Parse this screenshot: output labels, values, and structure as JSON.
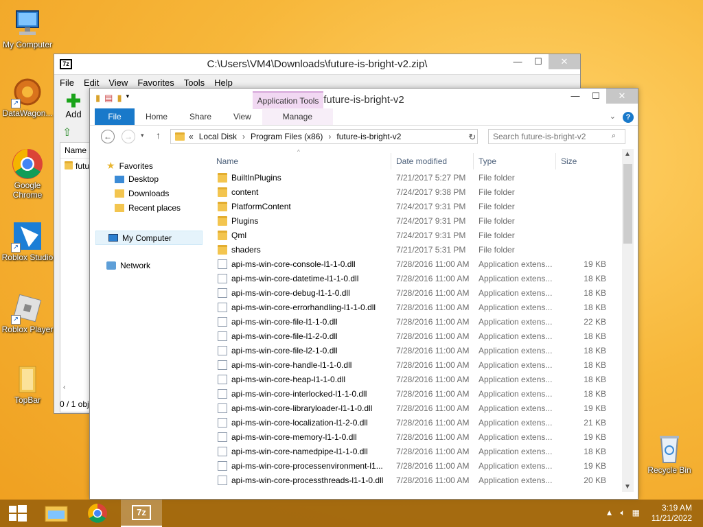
{
  "desktop_icons": [
    {
      "label": "My Computer",
      "icon": "my-computer-icon"
    },
    {
      "label": "DataWagon...",
      "icon": "datawagon-icon"
    },
    {
      "label": "Google Chrome",
      "icon": "chrome-icon"
    },
    {
      "label": "Roblox Studio",
      "icon": "roblox-studio-icon"
    },
    {
      "label": "Roblox Player",
      "icon": "roblox-player-icon"
    },
    {
      "label": "TopBar",
      "icon": "folder-icon"
    },
    {
      "label": "Recycle Bin",
      "icon": "recycle-bin-icon"
    }
  ],
  "sevenzip": {
    "title": "C:\\Users\\VM4\\Downloads\\future-is-bright-v2.zip\\",
    "logo": "7z",
    "menu": [
      "File",
      "Edit",
      "View",
      "Favorites",
      "Tools",
      "Help"
    ],
    "add_label": "Add",
    "column_name": "Name",
    "item_name": "futu",
    "status": "0 / 1 obj"
  },
  "explorer": {
    "title": "future-is-bright-v2",
    "context_tab": "Application Tools",
    "tabs": [
      "File",
      "Home",
      "Share",
      "View",
      "Manage"
    ],
    "address": [
      "«",
      "Local Disk",
      "Program Files (x86)",
      "future-is-bright-v2"
    ],
    "search_placeholder": "Search future-is-bright-v2",
    "nav": {
      "favorites": "Favorites",
      "desktop": "Desktop",
      "downloads": "Downloads",
      "recent": "Recent places",
      "computer": "My Computer",
      "network": "Network"
    },
    "columns": {
      "name": "Name",
      "date": "Date modified",
      "type": "Type",
      "size": "Size"
    },
    "rows": [
      {
        "name": "BuiltInPlugins",
        "date": "7/21/2017 5:27 PM",
        "type": "File folder",
        "size": "",
        "kind": "folder"
      },
      {
        "name": "content",
        "date": "7/24/2017 9:38 PM",
        "type": "File folder",
        "size": "",
        "kind": "folder"
      },
      {
        "name": "PlatformContent",
        "date": "7/24/2017 9:31 PM",
        "type": "File folder",
        "size": "",
        "kind": "folder"
      },
      {
        "name": "Plugins",
        "date": "7/24/2017 9:31 PM",
        "type": "File folder",
        "size": "",
        "kind": "folder"
      },
      {
        "name": "Qml",
        "date": "7/24/2017 9:31 PM",
        "type": "File folder",
        "size": "",
        "kind": "folder"
      },
      {
        "name": "shaders",
        "date": "7/21/2017 5:31 PM",
        "type": "File folder",
        "size": "",
        "kind": "folder"
      },
      {
        "name": "api-ms-win-core-console-l1-1-0.dll",
        "date": "7/28/2016 11:00 AM",
        "type": "Application extens...",
        "size": "19 KB",
        "kind": "file"
      },
      {
        "name": "api-ms-win-core-datetime-l1-1-0.dll",
        "date": "7/28/2016 11:00 AM",
        "type": "Application extens...",
        "size": "18 KB",
        "kind": "file"
      },
      {
        "name": "api-ms-win-core-debug-l1-1-0.dll",
        "date": "7/28/2016 11:00 AM",
        "type": "Application extens...",
        "size": "18 KB",
        "kind": "file"
      },
      {
        "name": "api-ms-win-core-errorhandling-l1-1-0.dll",
        "date": "7/28/2016 11:00 AM",
        "type": "Application extens...",
        "size": "18 KB",
        "kind": "file"
      },
      {
        "name": "api-ms-win-core-file-l1-1-0.dll",
        "date": "7/28/2016 11:00 AM",
        "type": "Application extens...",
        "size": "22 KB",
        "kind": "file"
      },
      {
        "name": "api-ms-win-core-file-l1-2-0.dll",
        "date": "7/28/2016 11:00 AM",
        "type": "Application extens...",
        "size": "18 KB",
        "kind": "file"
      },
      {
        "name": "api-ms-win-core-file-l2-1-0.dll",
        "date": "7/28/2016 11:00 AM",
        "type": "Application extens...",
        "size": "18 KB",
        "kind": "file"
      },
      {
        "name": "api-ms-win-core-handle-l1-1-0.dll",
        "date": "7/28/2016 11:00 AM",
        "type": "Application extens...",
        "size": "18 KB",
        "kind": "file"
      },
      {
        "name": "api-ms-win-core-heap-l1-1-0.dll",
        "date": "7/28/2016 11:00 AM",
        "type": "Application extens...",
        "size": "18 KB",
        "kind": "file"
      },
      {
        "name": "api-ms-win-core-interlocked-l1-1-0.dll",
        "date": "7/28/2016 11:00 AM",
        "type": "Application extens...",
        "size": "18 KB",
        "kind": "file"
      },
      {
        "name": "api-ms-win-core-libraryloader-l1-1-0.dll",
        "date": "7/28/2016 11:00 AM",
        "type": "Application extens...",
        "size": "19 KB",
        "kind": "file"
      },
      {
        "name": "api-ms-win-core-localization-l1-2-0.dll",
        "date": "7/28/2016 11:00 AM",
        "type": "Application extens...",
        "size": "21 KB",
        "kind": "file"
      },
      {
        "name": "api-ms-win-core-memory-l1-1-0.dll",
        "date": "7/28/2016 11:00 AM",
        "type": "Application extens...",
        "size": "19 KB",
        "kind": "file"
      },
      {
        "name": "api-ms-win-core-namedpipe-l1-1-0.dll",
        "date": "7/28/2016 11:00 AM",
        "type": "Application extens...",
        "size": "18 KB",
        "kind": "file"
      },
      {
        "name": "api-ms-win-core-processenvironment-l1...",
        "date": "7/28/2016 11:00 AM",
        "type": "Application extens...",
        "size": "19 KB",
        "kind": "file"
      },
      {
        "name": "api-ms-win-core-processthreads-l1-1-0.dll",
        "date": "7/28/2016 11:00 AM",
        "type": "Application extens...",
        "size": "20 KB",
        "kind": "file"
      }
    ]
  },
  "taskbar": {
    "time": "3:19 AM",
    "date": "11/21/2022",
    "apps": [
      "file-explorer-icon",
      "chrome-icon",
      "7zip-icon"
    ]
  },
  "colors": {
    "accent": "#1979ca",
    "context_tab": "#f1d8f2",
    "taskbar": "#965f0a"
  }
}
